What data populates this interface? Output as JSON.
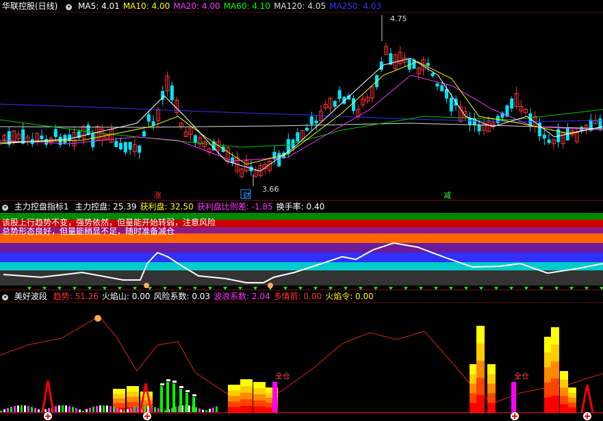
{
  "main": {
    "title": "华联控股(日线)",
    "ma": [
      {
        "label": "MA5: 4.01",
        "color": "#ffffff"
      },
      {
        "label": "MA10: 4.00",
        "color": "#ffff00"
      },
      {
        "label": "MA20: 4.00",
        "color": "#ff33ff"
      },
      {
        "label": "MA60: 4.10",
        "color": "#00ff00"
      },
      {
        "label": "MA120: 4.05",
        "color": "#dddddd"
      },
      {
        "label": "MA250: 4.03",
        "color": "#3333ff"
      }
    ],
    "high_label": "4.75",
    "low_label": "3.66",
    "markers": [
      {
        "text": "涨",
        "color": "#ff3333"
      },
      {
        "text": "财",
        "color": "#3399ff"
      },
      {
        "text": "减",
        "color": "#33ff33"
      }
    ]
  },
  "panel2": {
    "title": "主力控盘指标1",
    "fields": [
      {
        "label": "主力控盘: 25.39",
        "color": "#ffffff"
      },
      {
        "label": "获利盘: 32.50",
        "color": "#ffff00"
      },
      {
        "label": "获利盘比例差: -1.85",
        "color": "#ff33ff"
      },
      {
        "label": "换手率: 0.40",
        "color": "#ffffff"
      }
    ],
    "note1": "该股上行趋势不变，强势依然，但量能开始转弱，注意风险",
    "note2": "总势形态良好，但量能稍显不足，随时准备减仓"
  },
  "panel3": {
    "title": "美好波段",
    "fields": [
      {
        "label": "趋势: 51.26",
        "color": "#ff3333"
      },
      {
        "label": "火焰山: 0.00",
        "color": "#ffffff"
      },
      {
        "label": "风险系数: 0.03",
        "color": "#ffffff"
      },
      {
        "label": "波浪系数: 2.04",
        "color": "#ff33ff"
      },
      {
        "label": "多情箭: 0.00",
        "color": "#ff3333"
      },
      {
        "label": "火焰令: 0.00",
        "color": "#ffff00"
      }
    ],
    "tags": [
      {
        "text": "全仓",
        "color": "#ff4444"
      },
      {
        "text": "全仓",
        "color": "#ff4444"
      }
    ]
  },
  "colors": {
    "up": "#ff3333",
    "down": "#00e5ff",
    "separator": "#7a1010"
  }
}
